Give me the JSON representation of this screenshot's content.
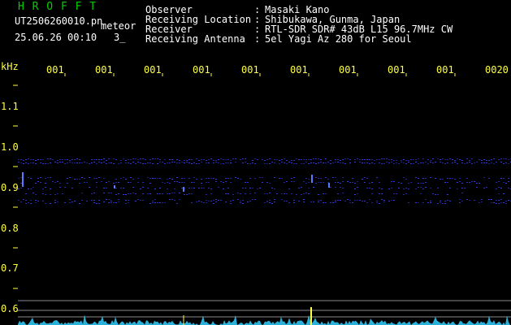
{
  "header": {
    "app_name": "H R O F F T",
    "file_name": "UT2506260010.pn",
    "mode_label": "meteor",
    "date_time": "25.06.26 00:10",
    "count": "3_",
    "info": [
      {
        "label": "Observer",
        "sep": ":",
        "value": "Masaki Kano"
      },
      {
        "label": "Receiving Location",
        "sep": ":",
        "value": "Shibukawa, Gunma, Japan"
      },
      {
        "label": "Receiver",
        "sep": ":",
        "value": "RTL-SDR SDR# 43dB L15 96.7MHz CW"
      },
      {
        "label": "Receiving Antenna",
        "sep": ":",
        "value": "5el Yagi Az 280 for Seoul"
      }
    ]
  },
  "axis": {
    "unit": "kHz",
    "y_ticks": [
      "1.1",
      "1.0",
      "0.9",
      "0.8",
      "0.7",
      "0.6"
    ],
    "time_ticks": [
      "001",
      "001",
      "001",
      "001",
      "001",
      "001",
      "001",
      "001",
      "001",
      "0020"
    ]
  },
  "colors": {
    "text_green": "#00d000",
    "text_yellow": "#ffff40",
    "background": "#000000",
    "signal_blue": "#3a3aff",
    "noise_cyan": "#30d0ff"
  }
}
